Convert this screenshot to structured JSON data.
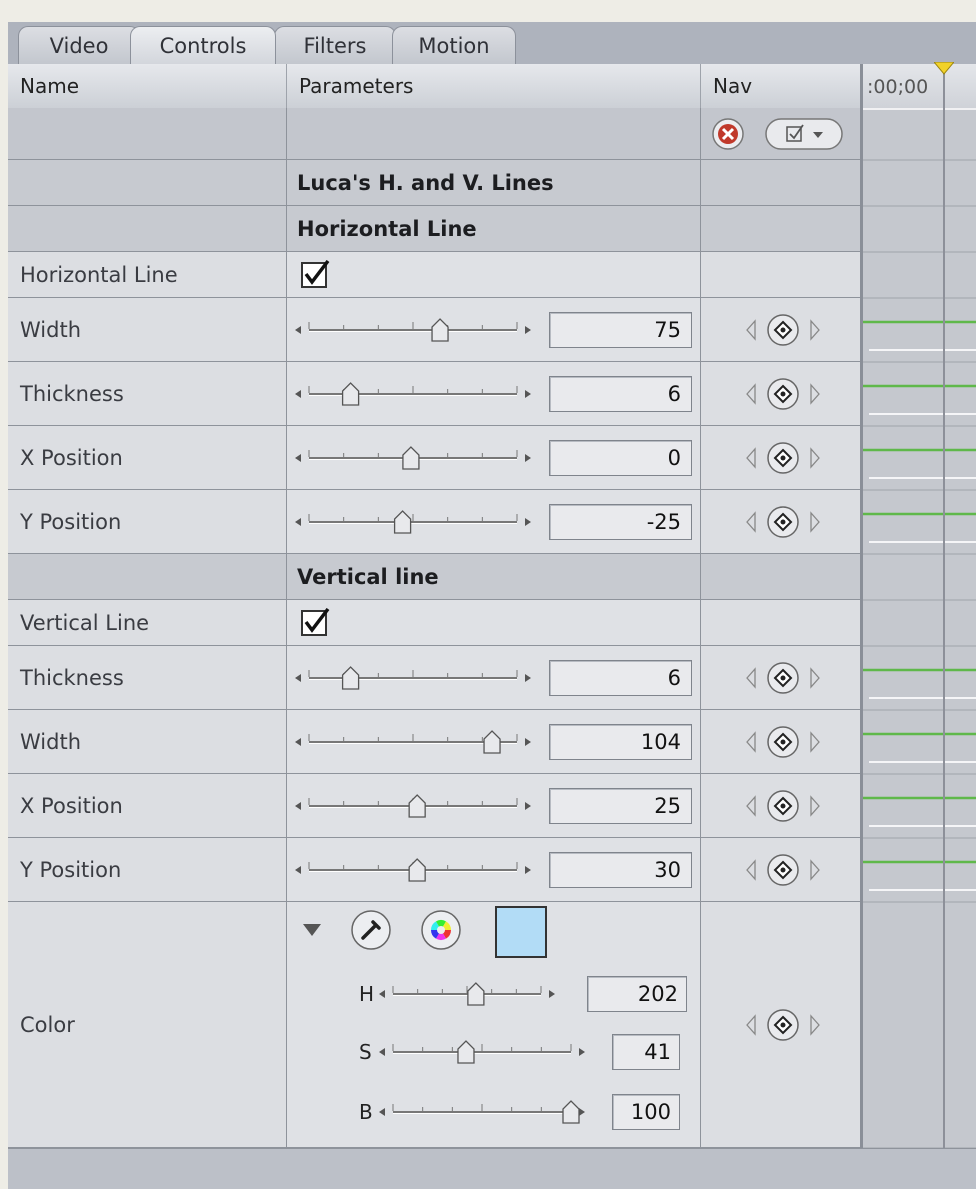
{
  "tabs": [
    "Video",
    "Controls",
    "Filters",
    "Motion"
  ],
  "active_tab": "Controls",
  "header": {
    "name": "Name",
    "parameters": "Parameters",
    "nav": "Nav"
  },
  "timeline": {
    "timecode": ":00;00"
  },
  "effect_title": "Luca's H. and V. Lines",
  "sections": {
    "horizontal": "Horizontal Line",
    "vertical": "Vertical line"
  },
  "checkboxes": {
    "horizontal": {
      "label": "Horizontal Line",
      "checked": true
    },
    "vertical": {
      "label": "Vertical Line",
      "checked": true
    }
  },
  "parameters": [
    {
      "label": "Width",
      "value": "75",
      "slider": 0.63
    },
    {
      "label": "Thickness",
      "value": "6",
      "slider": 0.2
    },
    {
      "label": "X Position",
      "value": "0",
      "slider": 0.49
    },
    {
      "label": "Y Position",
      "value": "-25",
      "slider": 0.45
    },
    {
      "label": "Thickness",
      "value": "6",
      "slider": 0.2
    },
    {
      "label": "Width",
      "value": "104",
      "slider": 0.88
    },
    {
      "label": "X Position",
      "value": "25",
      "slider": 0.52
    },
    {
      "label": "Y Position",
      "value": "30",
      "slider": 0.52
    }
  ],
  "color": {
    "label": "Color",
    "swatch": "#b2dcf6",
    "h": {
      "label": "H",
      "value": "202",
      "slider": 0.56
    },
    "s": {
      "label": "S",
      "value": "41",
      "slider": 0.41
    },
    "b": {
      "label": "B",
      "value": "100",
      "slider": 1.0
    }
  },
  "colors": {
    "keyframe_line": "#5fb84a",
    "delete_button": "#c0392b"
  }
}
